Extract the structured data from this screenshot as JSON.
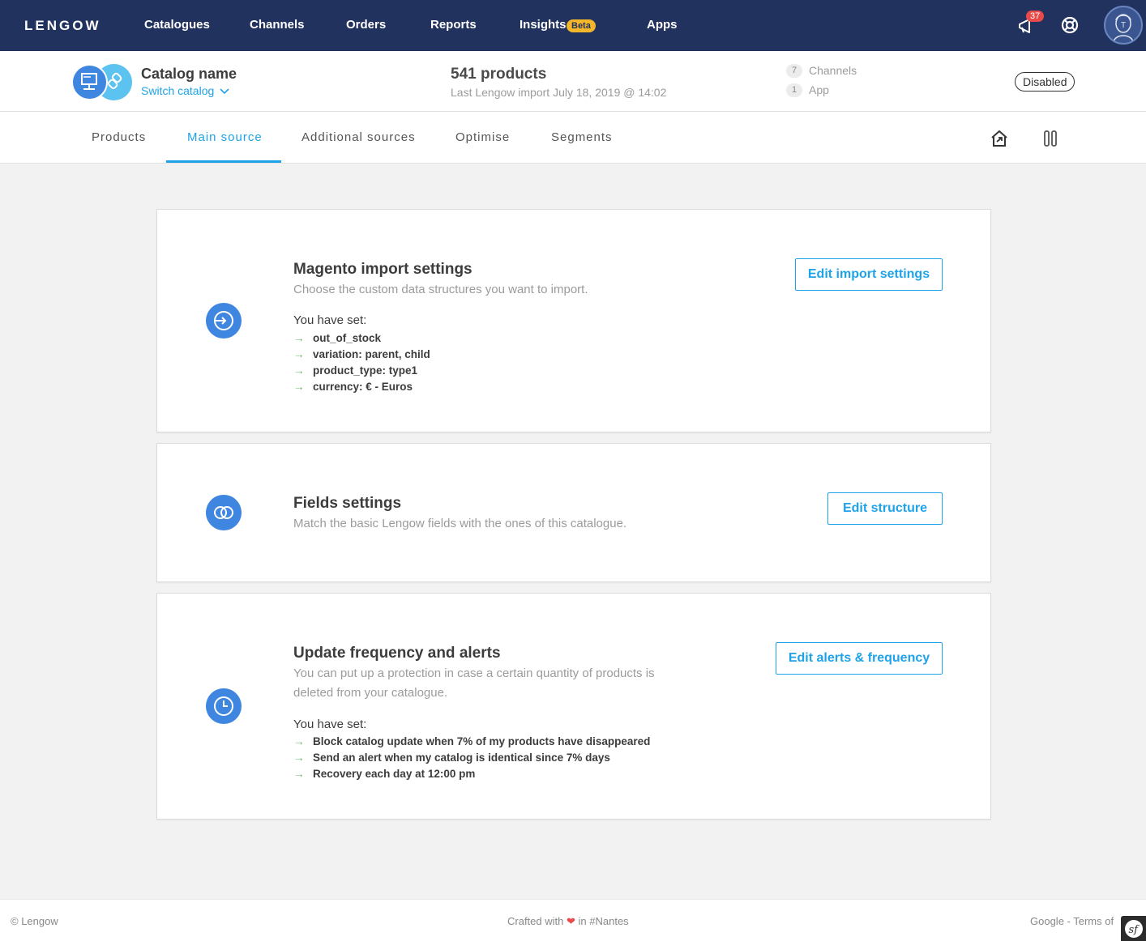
{
  "app": {
    "logo": "LENGOW",
    "nav": [
      "Catalogues",
      "Channels",
      "Orders",
      "Reports",
      "Insights",
      "Apps"
    ],
    "beta_badge": "Beta",
    "notification_count": "37",
    "avatar_initial": "T"
  },
  "catalog": {
    "name": "Catalog name",
    "switch_label": "Switch catalog",
    "products_count": "541 products",
    "last_import": "Last Lengow import July 18, 2019 @ 14:02",
    "channels_count": "7",
    "channels_label": "Channels",
    "apps_count": "1",
    "apps_label": "App",
    "status": "Disabled"
  },
  "tabs": [
    {
      "label": "Products"
    },
    {
      "label": "Main source"
    },
    {
      "label": "Additional sources"
    },
    {
      "label": "Optimise"
    },
    {
      "label": "Segments"
    }
  ],
  "active_tab": "Main source",
  "cards": {
    "import": {
      "title": "Magento import settings",
      "description": "Choose the custom data structures you want to import.",
      "set_label": "You have set:",
      "items": [
        "out_of_stock",
        "variation: parent, child",
        "product_type: type1",
        "currency: € - Euros"
      ],
      "button": "Edit import settings"
    },
    "fields": {
      "title": "Fields settings",
      "description": "Match the basic Lengow fields with the ones of this catalogue.",
      "button": "Edit structure"
    },
    "alerts": {
      "title": "Update frequency and alerts",
      "description_line1": "You can put up a protection in case a certain quantity of products is",
      "description_line2": "deleted from your catalogue.",
      "set_label": "You have set:",
      "items": [
        "Block catalog update when 7% of my products have disappeared",
        "Send an alert when my catalog is identical since 7% days",
        "Recovery each day at 12:00 pm"
      ],
      "button": "Edit alerts & frequency"
    }
  },
  "footer": {
    "copyright": "© Lengow",
    "crafted_before": "Crafted with",
    "crafted_after": "in #Nantes",
    "links": "Google - Terms of"
  },
  "colors": {
    "nav_bg": "#22325e",
    "accent": "#1fa3e8",
    "icon_blue": "#3f86e0",
    "check_green": "#5cb85c",
    "beta_yellow": "#f5b72a",
    "badge_red": "#e84a4a"
  }
}
